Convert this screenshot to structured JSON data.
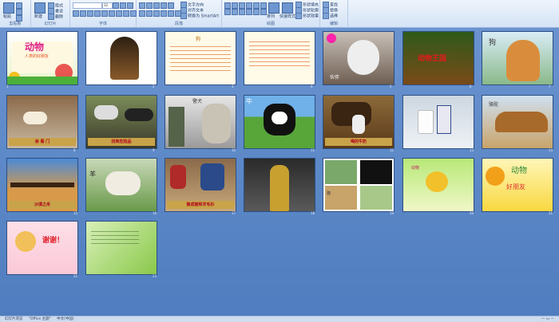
{
  "ribbon": {
    "groups": [
      {
        "label": "剪贴板"
      },
      {
        "label": "幻灯片"
      },
      {
        "label": "字体"
      },
      {
        "label": "段落"
      },
      {
        "label": "绘图"
      },
      {
        "label": "编辑"
      }
    ],
    "buttons": {
      "paste": "粘贴",
      "new_slide": "新建",
      "layout": "版式",
      "reset": "重设",
      "delete": "删除",
      "text_direction": "文字方向",
      "align_text": "对齐文本",
      "smartart": "转换为 SmartArt",
      "arrange": "排列",
      "quick_styles": "快速样式",
      "shape_fill": "形状填充",
      "shape_outline": "形状轮廓",
      "shape_effects": "形状效果",
      "find": "查找",
      "replace": "替换",
      "select": "选择"
    },
    "font_name": "",
    "font_size": "32"
  },
  "slides": [
    {
      "num": "1",
      "text": "动物",
      "sub": "人类的好朋友"
    },
    {
      "num": "2",
      "text": ""
    },
    {
      "num": "3",
      "text": "狗"
    },
    {
      "num": "4",
      "text": ""
    },
    {
      "num": "5",
      "text": "伙伴"
    },
    {
      "num": "6",
      "text": "动物王国"
    },
    {
      "num": "7",
      "text": "狗"
    },
    {
      "num": "8",
      "text": "会 看 门"
    },
    {
      "num": "9",
      "text": "找到危险品"
    },
    {
      "num": "10",
      "text": "警犬"
    },
    {
      "num": "11",
      "text": "牛"
    },
    {
      "num": "12",
      "text": "喝的牛奶"
    },
    {
      "num": "13",
      "text": ""
    },
    {
      "num": "14",
      "text": "骆驼"
    },
    {
      "num": "15",
      "text": "沙漠之舟"
    },
    {
      "num": "16",
      "text": "羊"
    },
    {
      "num": "17",
      "text": "做成被和羊毛衫"
    },
    {
      "num": "18",
      "text": ""
    },
    {
      "num": "19",
      "text": "骆"
    },
    {
      "num": "20",
      "text": "动物"
    },
    {
      "num": "21",
      "text": "动物",
      "sub": "好朋友"
    },
    {
      "num": "22",
      "text": "谢谢！"
    },
    {
      "num": "23",
      "text": ""
    }
  ],
  "status": {
    "slide_info": "幻灯片浏览",
    "theme": "\"Office 主题\"",
    "language": "中文(中国)"
  },
  "colors": {
    "accent": "#5b86c6",
    "caption_bg": "#c8a34a",
    "caption_text": "#b1001a"
  }
}
